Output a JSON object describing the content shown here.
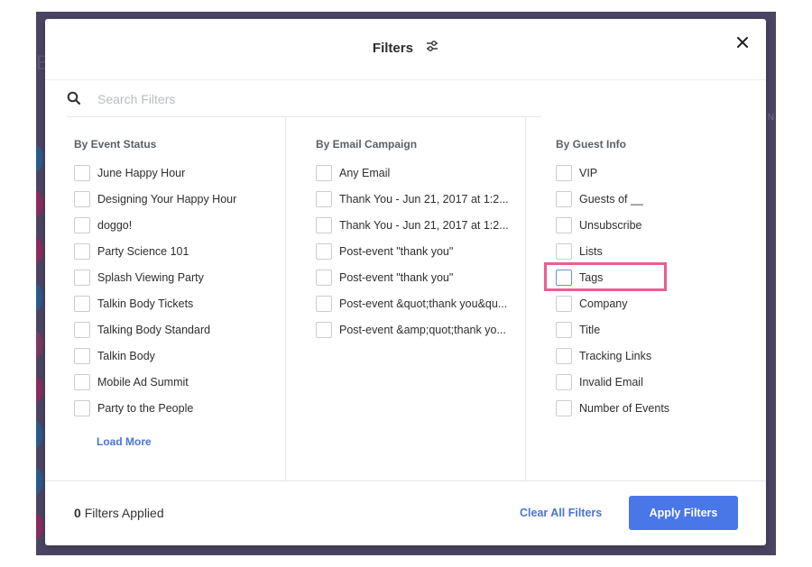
{
  "colors": {
    "accent": "#4a74d8",
    "apply_button": "#4a77e8",
    "highlight": "#ec5d93",
    "backdrop": "#4b4463"
  },
  "modal": {
    "title": "Filters",
    "title_icon": "sliders-icon",
    "close_icon": "close-icon"
  },
  "search": {
    "placeholder": "Search Filters",
    "value": "",
    "icon": "search-icon"
  },
  "columns": [
    {
      "title": "By Event Status",
      "items": [
        {
          "label": "June Happy Hour",
          "checked": false
        },
        {
          "label": "Designing Your Happy Hour",
          "checked": false
        },
        {
          "label": "doggo!",
          "checked": false
        },
        {
          "label": "Party Science 101",
          "checked": false
        },
        {
          "label": "Splash Viewing Party",
          "checked": false
        },
        {
          "label": "Talkin Body Tickets",
          "checked": false
        },
        {
          "label": "Talking Body Standard",
          "checked": false
        },
        {
          "label": "Talkin Body",
          "checked": false
        },
        {
          "label": "Mobile Ad Summit",
          "checked": false
        },
        {
          "label": "Party to the People",
          "checked": false
        }
      ],
      "load_more": "Load More"
    },
    {
      "title": "By Email Campaign",
      "items": [
        {
          "label": "Any Email",
          "checked": false
        },
        {
          "label": "Thank You - Jun 21, 2017 at 1:2...",
          "checked": false
        },
        {
          "label": "Thank You - Jun 21, 2017 at 1:2...",
          "checked": false
        },
        {
          "label": "Post-event \"thank you\"",
          "checked": false
        },
        {
          "label": "Post-event \"thank you\"",
          "checked": false
        },
        {
          "label": "Post-event &quot;thank you&qu...",
          "checked": false
        },
        {
          "label": "Post-event &amp;quot;thank yo...",
          "checked": false
        }
      ]
    },
    {
      "title": "By Guest Info",
      "items": [
        {
          "label": "VIP",
          "checked": false
        },
        {
          "label": "Guests of __",
          "checked": false
        },
        {
          "label": "Unsubscribe",
          "checked": false
        },
        {
          "label": "Lists",
          "checked": false
        },
        {
          "label": "Tags",
          "checked": false,
          "highlighted": true
        },
        {
          "label": "Company",
          "checked": false
        },
        {
          "label": "Title",
          "checked": false
        },
        {
          "label": "Tracking Links",
          "checked": false
        },
        {
          "label": "Invalid Email",
          "checked": false
        },
        {
          "label": "Number of Events",
          "checked": false
        }
      ]
    }
  ],
  "footer": {
    "applied_count": "0",
    "applied_label": "Filters Applied",
    "clear_all": "Clear All Filters",
    "apply": "Apply Filters"
  }
}
